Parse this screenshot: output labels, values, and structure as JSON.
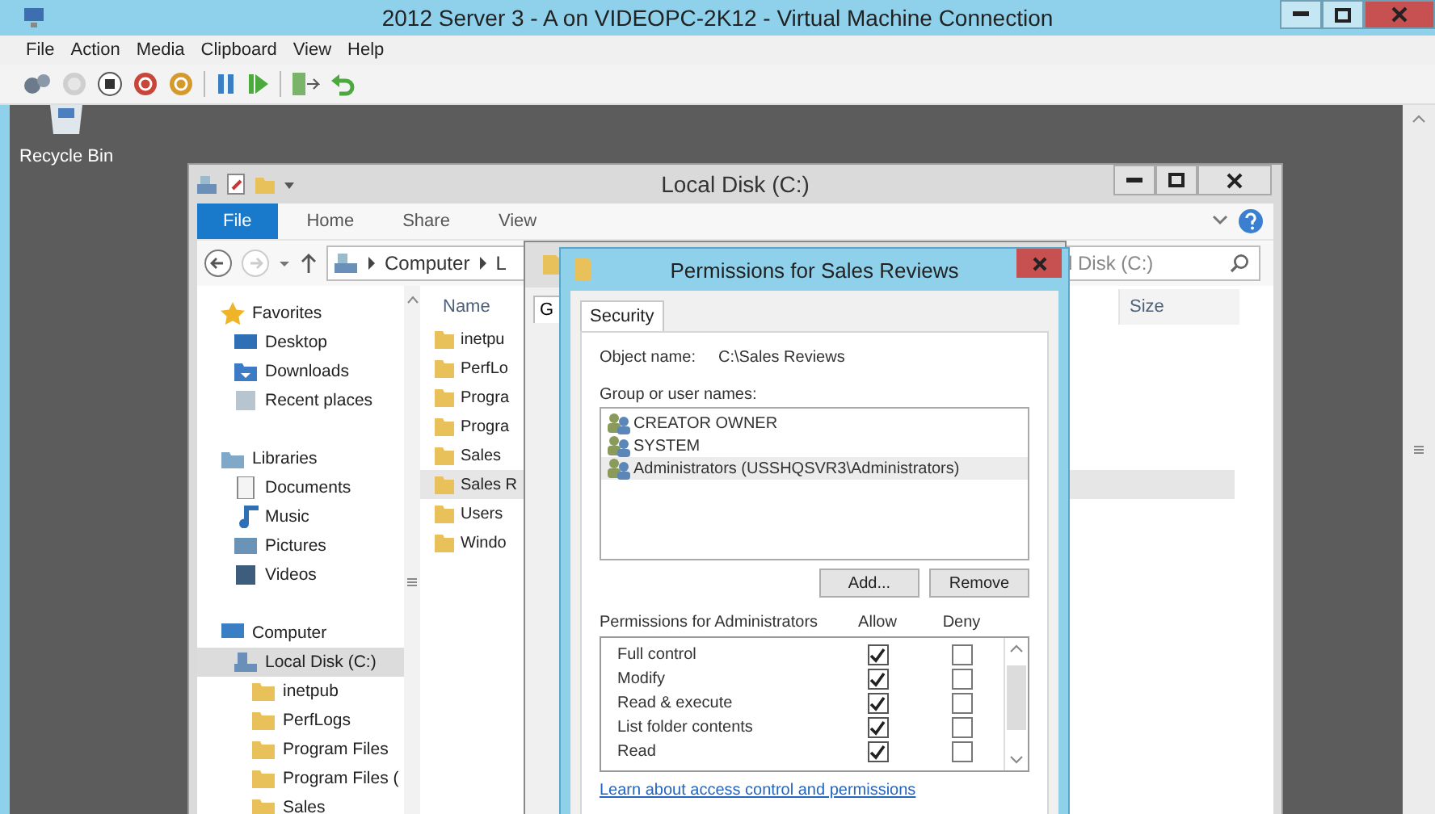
{
  "window": {
    "title": "2012 Server 3 - A on VIDEOPC-2K12 - Virtual Machine Connection"
  },
  "menu": [
    "File",
    "Action",
    "Media",
    "Clipboard",
    "View",
    "Help"
  ],
  "desktop": {
    "icons": [
      {
        "label": "Recycle Bin"
      }
    ]
  },
  "explorer": {
    "title": "Local Disk (C:)",
    "ribbon_tabs": [
      {
        "label": "File",
        "selected": true
      },
      {
        "label": "Home",
        "selected": false
      },
      {
        "label": "Share",
        "selected": false
      },
      {
        "label": "View",
        "selected": false
      }
    ],
    "address": [
      "Computer",
      "L"
    ],
    "search": {
      "value": "l Disk (C:)"
    },
    "navigation": [
      {
        "label": "Favorites",
        "selected": false,
        "children": [
          {
            "label": "Desktop",
            "selected": false
          },
          {
            "label": "Downloads",
            "selected": false
          },
          {
            "label": "Recent places",
            "selected": false
          }
        ]
      },
      {
        "label": "Libraries",
        "selected": false,
        "children": [
          {
            "label": "Documents",
            "selected": false
          },
          {
            "label": "Music",
            "selected": false
          },
          {
            "label": "Pictures",
            "selected": false
          },
          {
            "label": "Videos",
            "selected": false
          }
        ]
      },
      {
        "label": "Computer",
        "selected": false,
        "children": [
          {
            "label": "Local Disk (C:)",
            "selected": true,
            "children": [
              {
                "label": "inetpub",
                "selected": false
              },
              {
                "label": "PerfLogs",
                "selected": false
              },
              {
                "label": "Program Files",
                "selected": false
              },
              {
                "label": "Program Files (",
                "selected": false
              },
              {
                "label": "Sales",
                "selected": false
              }
            ]
          }
        ]
      }
    ],
    "columns": [
      "Name",
      "Size"
    ],
    "files": [
      {
        "name": "inetpu",
        "selected": false
      },
      {
        "name": "PerfLo",
        "selected": false
      },
      {
        "name": "Progra",
        "selected": false
      },
      {
        "name": "Progra",
        "selected": false
      },
      {
        "name": "Sales",
        "selected": false
      },
      {
        "name": "Sales R",
        "selected": true
      },
      {
        "name": "Users",
        "selected": false
      },
      {
        "name": "Windo",
        "selected": false
      }
    ]
  },
  "properties_window": {
    "tab": "G"
  },
  "dialog": {
    "title": "Permissions for Sales Reviews",
    "tabs": [
      {
        "label": "Security",
        "selected": true
      }
    ],
    "object_label": "Object name:",
    "object_value": "C:\\Sales Reviews",
    "users_label": "Group or user names:",
    "users": [
      {
        "name": "CREATOR OWNER",
        "selected": false
      },
      {
        "name": "SYSTEM",
        "selected": false
      },
      {
        "name": "Administrators (USSHQSVR3\\Administrators)",
        "selected": true
      }
    ],
    "buttons": [
      "Add...",
      "Remove"
    ],
    "permissions_label": "Permissions for Administrators",
    "allow_label": "Allow",
    "deny_label": "Deny",
    "permissions": [
      {
        "name": "Full control",
        "allow": true,
        "deny": false
      },
      {
        "name": "Modify",
        "allow": true,
        "deny": false
      },
      {
        "name": "Read & execute",
        "allow": true,
        "deny": false
      },
      {
        "name": "List folder contents",
        "allow": true,
        "deny": false
      },
      {
        "name": "Read",
        "allow": true,
        "deny": false
      }
    ],
    "link": "Learn about access control and permissions"
  }
}
